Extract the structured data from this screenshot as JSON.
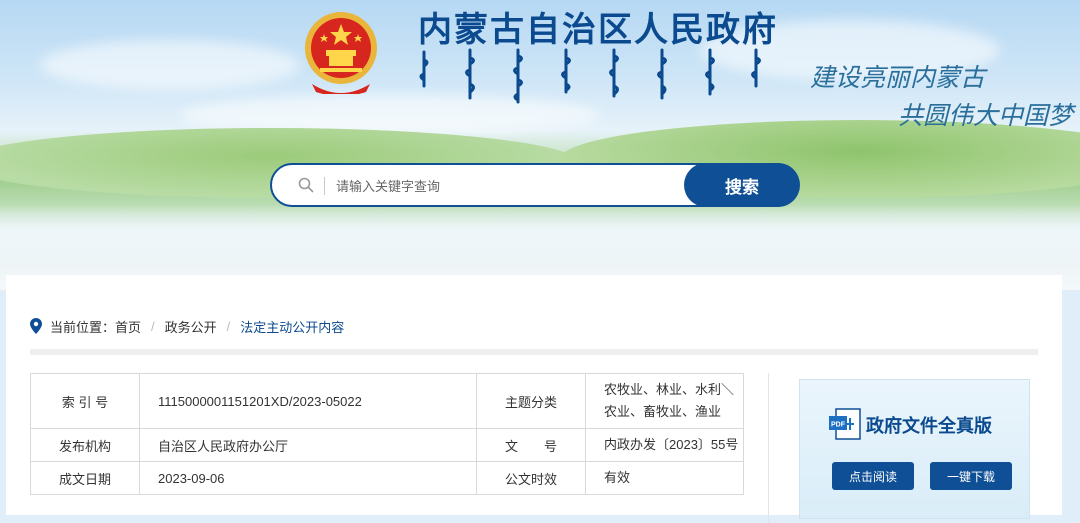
{
  "header": {
    "site_title": "内蒙古自治区人民政府",
    "slogan_line1": "建设亮丽内蒙古",
    "slogan_line2": "共圆伟大中国梦"
  },
  "search": {
    "placeholder": "请输入关键字查询",
    "button_label": "搜索"
  },
  "breadcrumb": {
    "prefix": "当前位置：",
    "items": [
      "首页",
      "政务公开",
      "法定主动公开内容"
    ],
    "separator": "/"
  },
  "doc_meta": {
    "rows": [
      {
        "label1": "索 引 号",
        "value1": "1115000001151201XD/2023-05022",
        "label2": "主题分类",
        "value2": "农牧业、林业、水利＼农业、畜牧业、渔业"
      },
      {
        "label1": "发布机构",
        "value1": "自治区人民政府办公厅",
        "label2": "文　　号",
        "value2": "内政办发〔2023〕55号"
      },
      {
        "label1": "成文日期",
        "value1": "2023-09-06",
        "label2": "公文时效",
        "value2": "有效"
      }
    ]
  },
  "doc_panel": {
    "title": "政府文件全真版",
    "read_label": "点击阅读",
    "download_label": "一键下载"
  },
  "colors": {
    "brand_blue": "#0f4f96",
    "title_blue": "#0b4a8f"
  }
}
